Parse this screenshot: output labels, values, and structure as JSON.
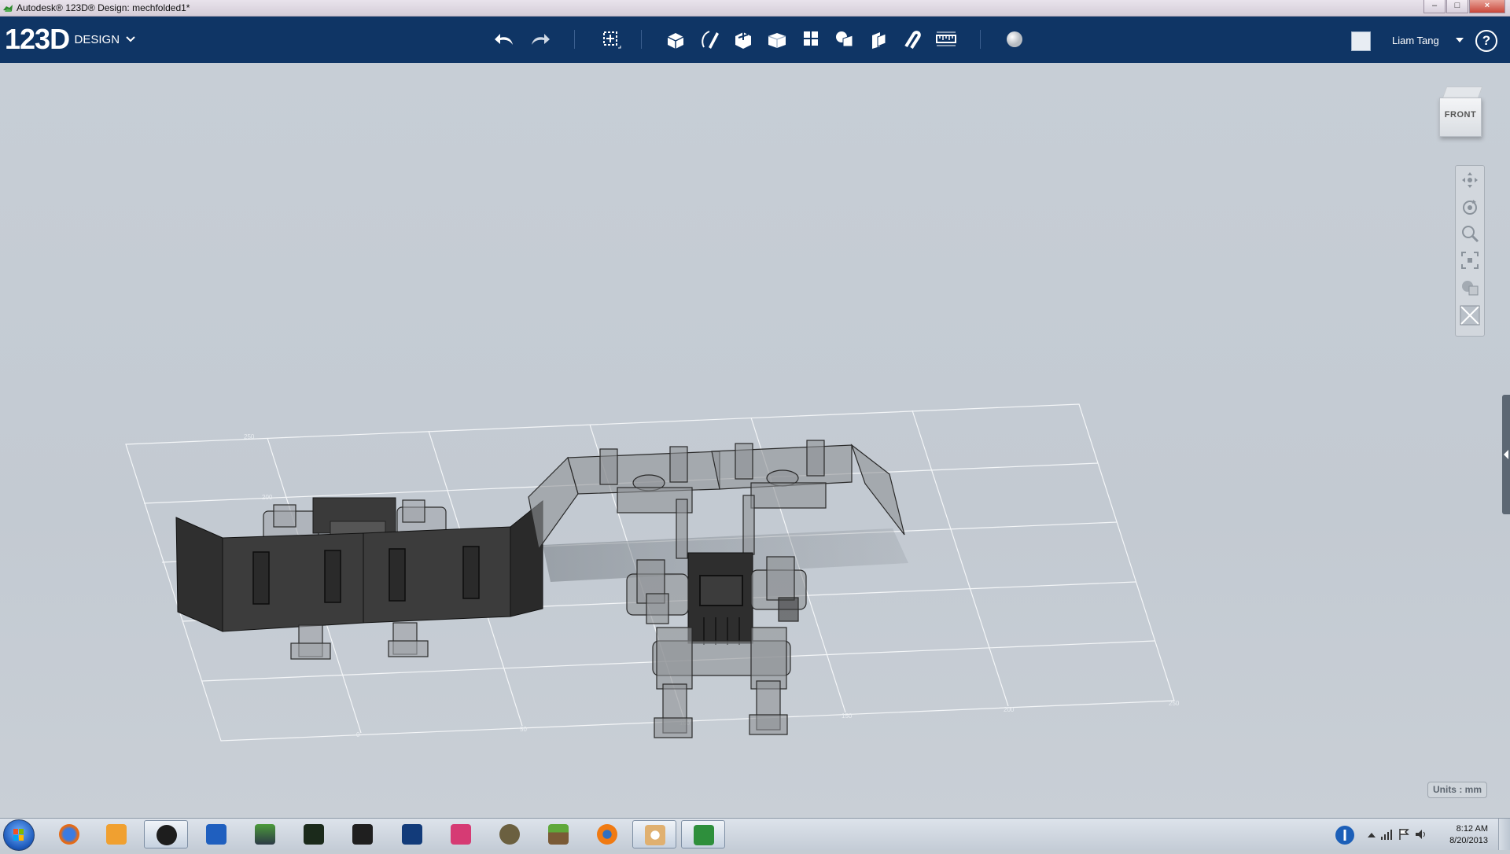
{
  "window": {
    "title": "Autodesk® 123D® Design: mechfolded1*",
    "controls": [
      "minimize",
      "maximize",
      "close"
    ],
    "close_glyph": "×",
    "min_glyph": "–",
    "max_glyph": "□"
  },
  "toolbar": {
    "logo_num": "123D",
    "logo_word": "DESIGN",
    "tools": [
      {
        "name": "undo-icon"
      },
      {
        "name": "redo-icon"
      },
      {
        "name": "transform-icon"
      },
      {
        "name": "primitives-icon"
      },
      {
        "name": "sketch-icon"
      },
      {
        "name": "construct-icon"
      },
      {
        "name": "modify-icon"
      },
      {
        "name": "pattern-icon"
      },
      {
        "name": "grouping-icon"
      },
      {
        "name": "combine-icon"
      },
      {
        "name": "snap-icon"
      },
      {
        "name": "measure-icon"
      },
      {
        "name": "material-icon"
      }
    ],
    "user_name": "Liam Tang",
    "help_glyph": "?"
  },
  "viewport": {
    "viewcube_label": "FRONT",
    "units_label": "Units : mm",
    "grid_labels": [
      "250",
      "200",
      "50",
      "100",
      "150",
      "200",
      "250",
      "0"
    ],
    "grid_color": "#f4f6f8",
    "background_color": "#c5ccd3"
  },
  "navbar": {
    "tools": [
      "pan-icon",
      "orbit-icon",
      "zoom-icon",
      "fit-icon",
      "view-style-icon",
      "materials-outline-icon"
    ]
  },
  "taskbar": {
    "apps": [
      "firefox",
      "media-player",
      "hp",
      "paint-net-blue",
      "inkscape",
      "stencyl",
      "mischief",
      "fraps-butterfly",
      "krita-pen",
      "gimp",
      "minecraft",
      "blender",
      "paint",
      "123d-design"
    ],
    "time": "8:12 AM",
    "date": "8/20/2013"
  },
  "colors": {
    "title_bar": "#dcd4de",
    "toolbar": "#0f3565",
    "taskbar": "#cfd6df",
    "model_dark": "#3a3a3a",
    "model_translucent": "#8f9296"
  }
}
